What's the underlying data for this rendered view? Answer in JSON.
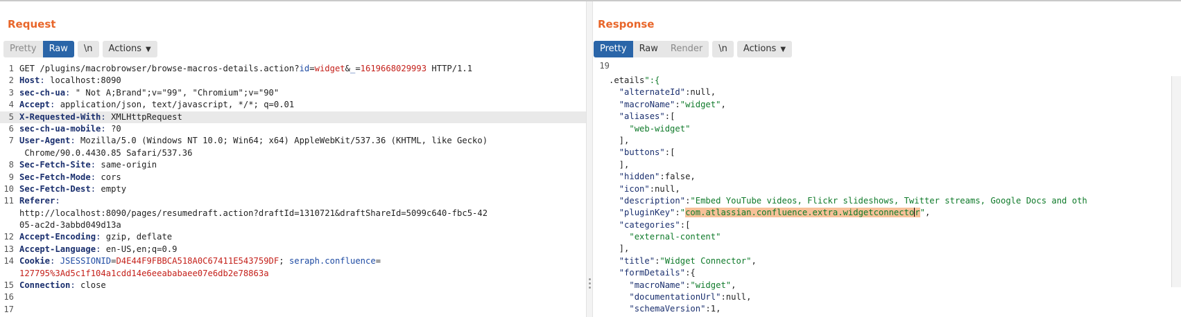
{
  "request": {
    "title": "Request",
    "tabs": {
      "pretty": "Pretty",
      "raw": "Raw",
      "newline": "\\n",
      "actions": "Actions"
    },
    "lines": [
      {
        "n": "1",
        "method": "GET ",
        "path": "/plugins/macrobrowser/browse-macros-details.action?",
        "q1k": "id",
        "q1e": "=",
        "q1v": "widget",
        "amp": "&",
        "q2k": "_",
        "q2e": "=",
        "q2v": "1619668029993",
        "proto": " HTTP/1.1"
      },
      {
        "n": "2",
        "name": "Host",
        "value": " localhost:8090"
      },
      {
        "n": "3",
        "name": "sec-ch-ua",
        "value": " \" Not A;Brand\";v=\"99\", \"Chromium\";v=\"90\""
      },
      {
        "n": "4",
        "name": "Accept",
        "value": " application/json, text/javascript, */*; q=0.01"
      },
      {
        "n": "5",
        "name": "X-Requested-With",
        "value": " XMLHttpRequest"
      },
      {
        "n": "6",
        "name": "sec-ch-ua-mobile",
        "value": " ?0"
      },
      {
        "n": "7",
        "name": "User-Agent",
        "value": " Mozilla/5.0 (Windows NT 10.0; Win64; x64) AppleWebKit/537.36 (KHTML, like Gecko)"
      },
      {
        "n": "",
        "cont": "Chrome/90.0.4430.85 Safari/537.36"
      },
      {
        "n": "8",
        "name": "Sec-Fetch-Site",
        "value": " same-origin"
      },
      {
        "n": "9",
        "name": "Sec-Fetch-Mode",
        "value": " cors"
      },
      {
        "n": "10",
        "name": "Sec-Fetch-Dest",
        "value": " empty"
      },
      {
        "n": "11",
        "name": "Referer",
        "value": ""
      },
      {
        "n": "",
        "wrap": "http://localhost:8090/pages/resumedraft.action?draftId=1310721&draftShareId=5099c640-fbc5-42"
      },
      {
        "n": "",
        "wrap": "05-ac2d-3abbd049d13a"
      },
      {
        "n": "12",
        "name": "Accept-Encoding",
        "value": " gzip, deflate"
      },
      {
        "n": "13",
        "name": "Accept-Language",
        "value": " en-US,en;q=0.9"
      },
      {
        "n": "14",
        "name": "Cookie",
        "c1k": "JSESSIONID",
        "c1e": "=",
        "c1v": "D4E44F9FBBCA518A0C67411E543759DF",
        "sep": "; ",
        "c2k": "seraph.confluence",
        "c2e": "="
      },
      {
        "n": "",
        "redwrap": "127795%3Ad5c1f104a1cdd14e6eeababaee07e6db2e78863a"
      },
      {
        "n": "15",
        "name": "Connection",
        "value": " close"
      },
      {
        "n": "16"
      },
      {
        "n": "17"
      }
    ]
  },
  "response": {
    "title": "Response",
    "tabs": {
      "pretty": "Pretty",
      "raw": "Raw",
      "render": "Render",
      "newline": "\\n",
      "actions": "Actions"
    },
    "first_line_number": "19",
    "lines": [
      ".etails\":{",
      "  \"alternateId\":null,",
      "  \"macroName\":\"widget\",",
      "  \"aliases\":[",
      "    \"web-widget\"",
      "  ],",
      "  \"buttons\":[",
      "  ],",
      "  \"hidden\":false,",
      "  \"icon\":null,",
      "  \"description\":\"Embed YouTube videos, Flickr slideshows, Twitter streams, Google Docs and oth",
      "  \"pluginKey\":\"com.atlassian.confluence.extra.widgetconnector\",",
      "  \"categories\":[",
      "    \"external-content\"",
      "  ],",
      "  \"title\":\"Widget Connector\",",
      "  \"formDetails\":{",
      "    \"macroName\":\"widget\",",
      "    \"documentationUrl\":null,",
      "    \"schemaVersion\":1,"
    ]
  },
  "colors": {
    "accent": "#e8662a",
    "active_tab": "#2a65a8",
    "header_name": "#1a2f6e",
    "param_value": "#c4201a",
    "json_string": "#0f7a2a",
    "selection": "#f7c199"
  }
}
